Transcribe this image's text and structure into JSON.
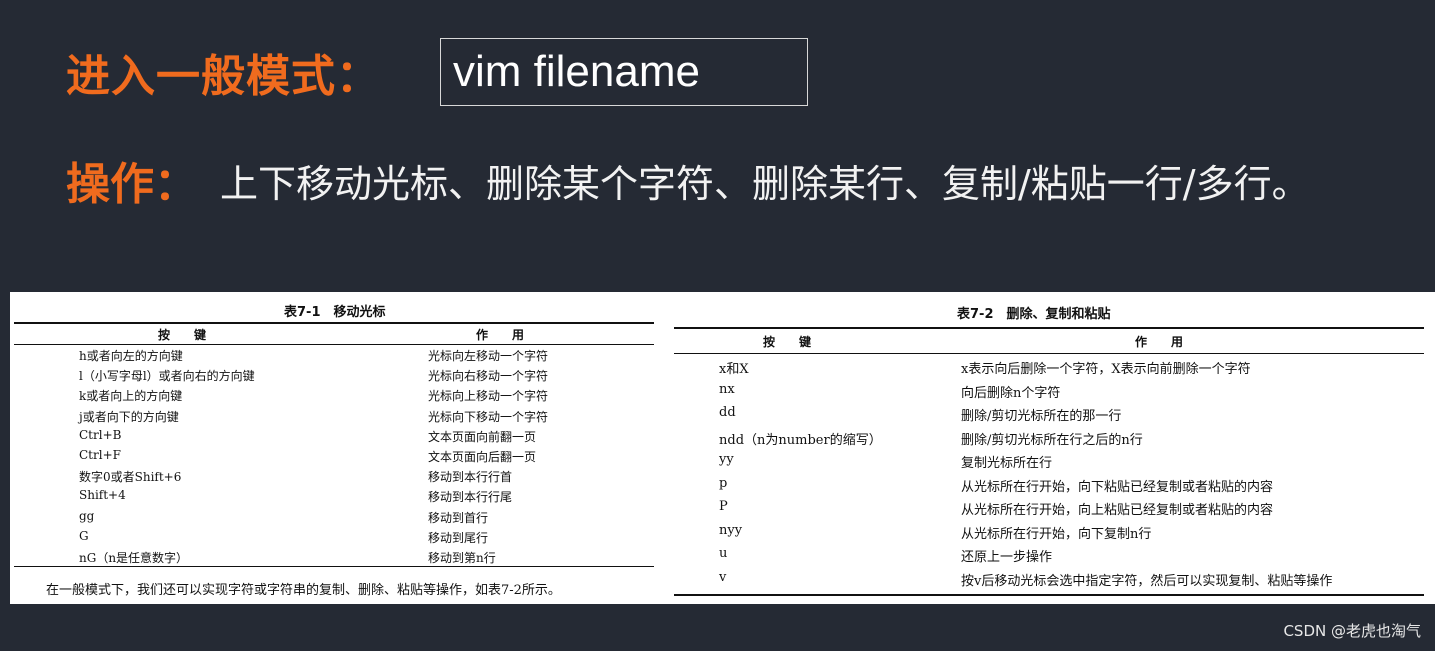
{
  "slide": {
    "title_label": "进入一般模式：",
    "command": "vim filename",
    "ops_label": "操作：",
    "ops_text": "上下移动光标、删除某个字符、删除某行、复制/粘贴一行/多行。"
  },
  "table1": {
    "caption": "表7-1　移动光标",
    "headers": [
      "按　键",
      "作　用"
    ],
    "rows": [
      [
        "h或者向左的方向键",
        "光标向左移动一个字符"
      ],
      [
        "l（小写字母l）或者向右的方向键",
        "光标向右移动一个字符"
      ],
      [
        "k或者向上的方向键",
        "光标向上移动一个字符"
      ],
      [
        "j或者向下的方向键",
        "光标向下移动一个字符"
      ],
      [
        "Ctrl+B",
        "文本页面向前翻一页"
      ],
      [
        "Ctrl+F",
        "文本页面向后翻一页"
      ],
      [
        "数字0或者Shift+6",
        "移动到本行行首"
      ],
      [
        "Shift+4",
        "移动到本行行尾"
      ],
      [
        "gg",
        "移动到首行"
      ],
      [
        "G",
        "移动到尾行"
      ],
      [
        "nG（n是任意数字）",
        "移动到第n行"
      ]
    ],
    "footnote": "在一般模式下，我们还可以实现字符或字符串的复制、删除、粘贴等操作，如表7-2所示。"
  },
  "table2": {
    "caption": "表7-2　删除、复制和粘贴",
    "headers": [
      "按　键",
      "作　用"
    ],
    "rows": [
      [
        "x和X",
        "x表示向后删除一个字符，X表示向前删除一个字符"
      ],
      [
        "nx",
        "向后删除n个字符"
      ],
      [
        "dd",
        "删除/剪切光标所在的那一行"
      ],
      [
        "ndd（n为number的缩写）",
        "删除/剪切光标所在行之后的n行"
      ],
      [
        "yy",
        "复制光标所在行"
      ],
      [
        "p",
        "从光标所在行开始，向下粘贴已经复制或者粘贴的内容"
      ],
      [
        "P",
        "从光标所在行开始，向上粘贴已经复制或者粘贴的内容"
      ],
      [
        "nyy",
        "从光标所在行开始，向下复制n行"
      ],
      [
        "u",
        "还原上一步操作"
      ],
      [
        "v",
        "按v后移动光标会选中指定字符，然后可以实现复制、粘贴等操作"
      ]
    ]
  },
  "credit": "CSDN @老虎也淘气",
  "colors": {
    "background": "#252a34",
    "accent": "#f06b1e",
    "text": "#f2f2f2"
  }
}
